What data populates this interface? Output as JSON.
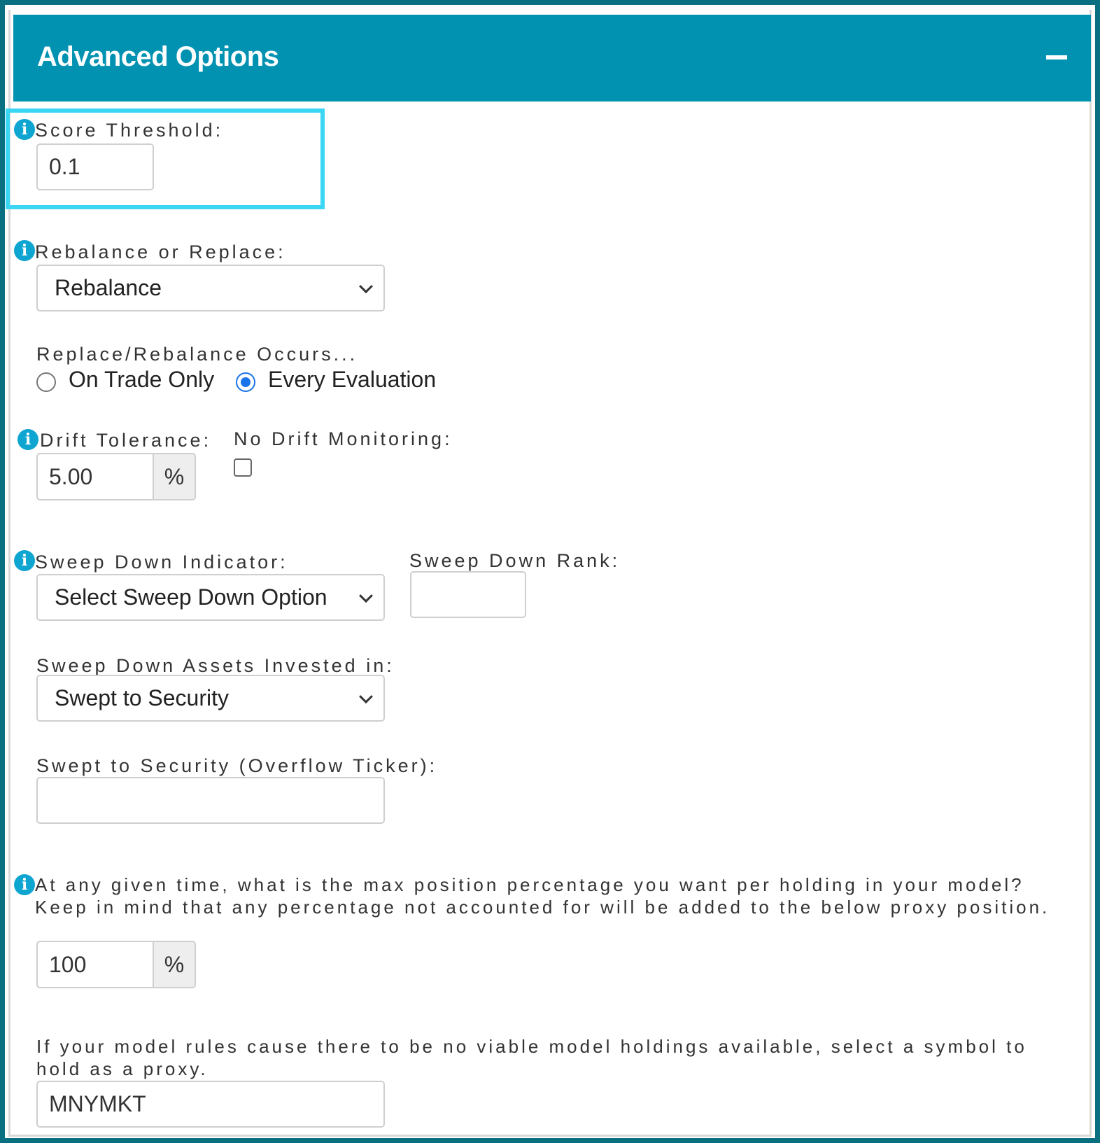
{
  "header": {
    "title": "Advanced Options",
    "collapse_icon": "minus-icon"
  },
  "score_threshold": {
    "label": "Score Threshold:",
    "value": "0.1"
  },
  "rebalance_or_replace": {
    "label": "Rebalance or Replace:",
    "selected": "Rebalance"
  },
  "occurs": {
    "label": "Replace/Rebalance Occurs...",
    "options": [
      {
        "label": "On Trade Only",
        "checked": false
      },
      {
        "label": "Every Evaluation",
        "checked": true
      }
    ]
  },
  "drift_tolerance": {
    "label": "Drift Tolerance:",
    "value": "5.00",
    "addon": "%"
  },
  "no_drift_monitoring": {
    "label": "No Drift Monitoring:",
    "checked": false
  },
  "sweep_down_indicator": {
    "label": "Sweep Down Indicator:",
    "selected": "Select Sweep Down Option"
  },
  "sweep_down_rank": {
    "label": "Sweep Down Rank:",
    "value": ""
  },
  "sweep_down_assets": {
    "label": "Sweep Down Assets Invested in:",
    "selected": "Swept to Security"
  },
  "swept_to_security": {
    "label": "Swept to Security (Overflow Ticker):",
    "value": ""
  },
  "max_position": {
    "label": "At any given time, what is the max position percentage you want per holding in your model? Keep in mind that any percentage not accounted for will be added to the below proxy position.",
    "value": "100",
    "addon": "%"
  },
  "proxy": {
    "label": "If your model rules cause there to be no viable model holdings available, select a symbol to hold as a proxy.",
    "value": "MNYMKT"
  },
  "colors": {
    "header": "#0192b2",
    "frame": "#0b6f82",
    "highlight": "#3ad6f4",
    "info": "#0ea5d1",
    "radio_active": "#1a73e8"
  }
}
